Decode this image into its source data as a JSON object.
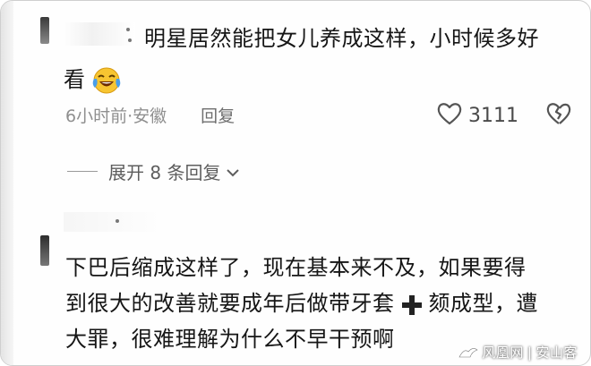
{
  "comment1": {
    "text_line1": "明星居然能把女儿养成这样，小时候多好",
    "text_line2": "看",
    "emoji": "laughing-crying-emoji",
    "time_location": "6小时前·安徽",
    "reply_label": "回复",
    "like_count": "3111",
    "expand_label": "展开 8 条回复"
  },
  "comment2": {
    "line1": "下巴后缩成这样了，现在基本来不及，如果要得",
    "line2_a": "到很大的改善就要成年后做带牙套",
    "line2_b": "颏成型，遭",
    "line3": "大罪，很难理解为什么不早干预啊"
  },
  "watermark": {
    "brand": "风凰网",
    "author": "安山客"
  },
  "colors": {
    "text": "#161616",
    "meta": "#8f8f8f",
    "emoji_face": "#f7c531",
    "emoji_tears": "#4a9ee8"
  }
}
